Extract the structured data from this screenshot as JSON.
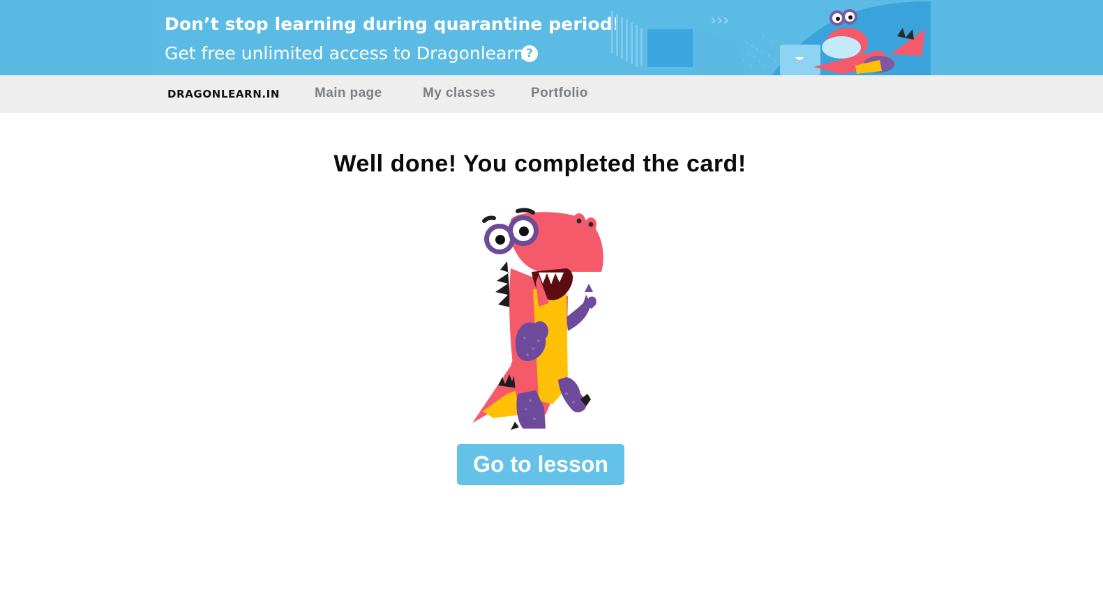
{
  "banner": {
    "title": "Don’t stop learning during quarantine period!",
    "subtitle": "Get free unlimited access to Dragonlearn",
    "help_icon": "question-mark-icon",
    "help_glyph": "?",
    "color": "#5cbbe5"
  },
  "nav": {
    "logo": "DRAGONLEARN.IN",
    "links": [
      "Main page",
      "My classes",
      "Portfolio"
    ]
  },
  "main": {
    "heading": "Well done! You completed the card!",
    "button_label": "Go to lesson",
    "button_color": "#64c2e8"
  }
}
